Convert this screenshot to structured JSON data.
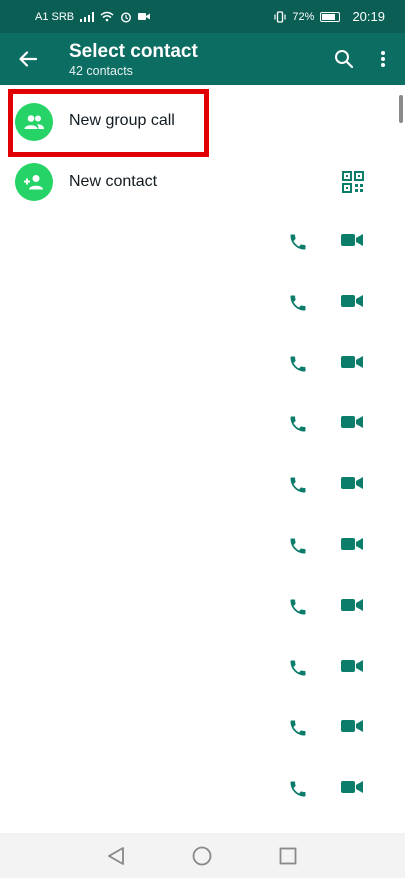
{
  "status_bar": {
    "carrier": "A1 SRB",
    "battery": "72%",
    "time": "20:19"
  },
  "app_bar": {
    "title": "Select contact",
    "subtitle": "42 contacts",
    "back_icon": "arrow-left-icon",
    "search_icon": "search-icon",
    "more_icon": "more-vert-icon"
  },
  "actions": [
    {
      "label": "New group call",
      "icon": "group-icon"
    },
    {
      "label": "New contact",
      "icon": "person-add-icon"
    }
  ],
  "colors": {
    "header": "#0c6d62",
    "status_bar": "#0a5e54",
    "accent_green": "#25d366",
    "icon_teal": "#0c7c6b",
    "highlight_red": "#e00000"
  },
  "contacts": [
    {
      "call_icon": "phone-icon",
      "video_icon": "video-icon"
    },
    {
      "call_icon": "phone-icon",
      "video_icon": "video-icon"
    },
    {
      "call_icon": "phone-icon",
      "video_icon": "video-icon"
    },
    {
      "call_icon": "phone-icon",
      "video_icon": "video-icon"
    },
    {
      "call_icon": "phone-icon",
      "video_icon": "video-icon"
    },
    {
      "call_icon": "phone-icon",
      "video_icon": "video-icon"
    },
    {
      "call_icon": "phone-icon",
      "video_icon": "video-icon"
    },
    {
      "call_icon": "phone-icon",
      "video_icon": "video-icon"
    },
    {
      "call_icon": "phone-icon",
      "video_icon": "video-icon"
    },
    {
      "call_icon": "phone-icon",
      "video_icon": "video-icon"
    }
  ]
}
